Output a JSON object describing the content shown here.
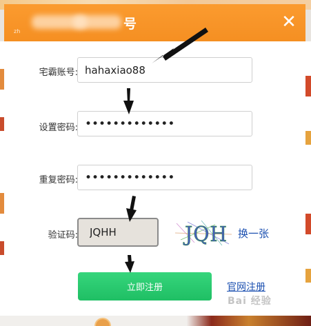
{
  "dialog": {
    "title": "号",
    "close_icon": "close-icon",
    "accent_color": "#f58f22"
  },
  "form": {
    "account": {
      "label": "宅霸账号:",
      "value": "hahaxiao88"
    },
    "password": {
      "label": "设置密码:",
      "value": "•••••••••••••"
    },
    "confirm_password": {
      "label": "重复密码:",
      "value": "•••••••••••••"
    },
    "captcha": {
      "label": "验证码:",
      "value": "JQHH",
      "image_text": "JQH"
    },
    "refresh_label": "换一张",
    "submit_label": "立即注册",
    "submit_color": "#1fbf64",
    "official_register_label": "官网注册",
    "link_color": "#1a4fb0"
  },
  "watermark": "Bai 经验"
}
